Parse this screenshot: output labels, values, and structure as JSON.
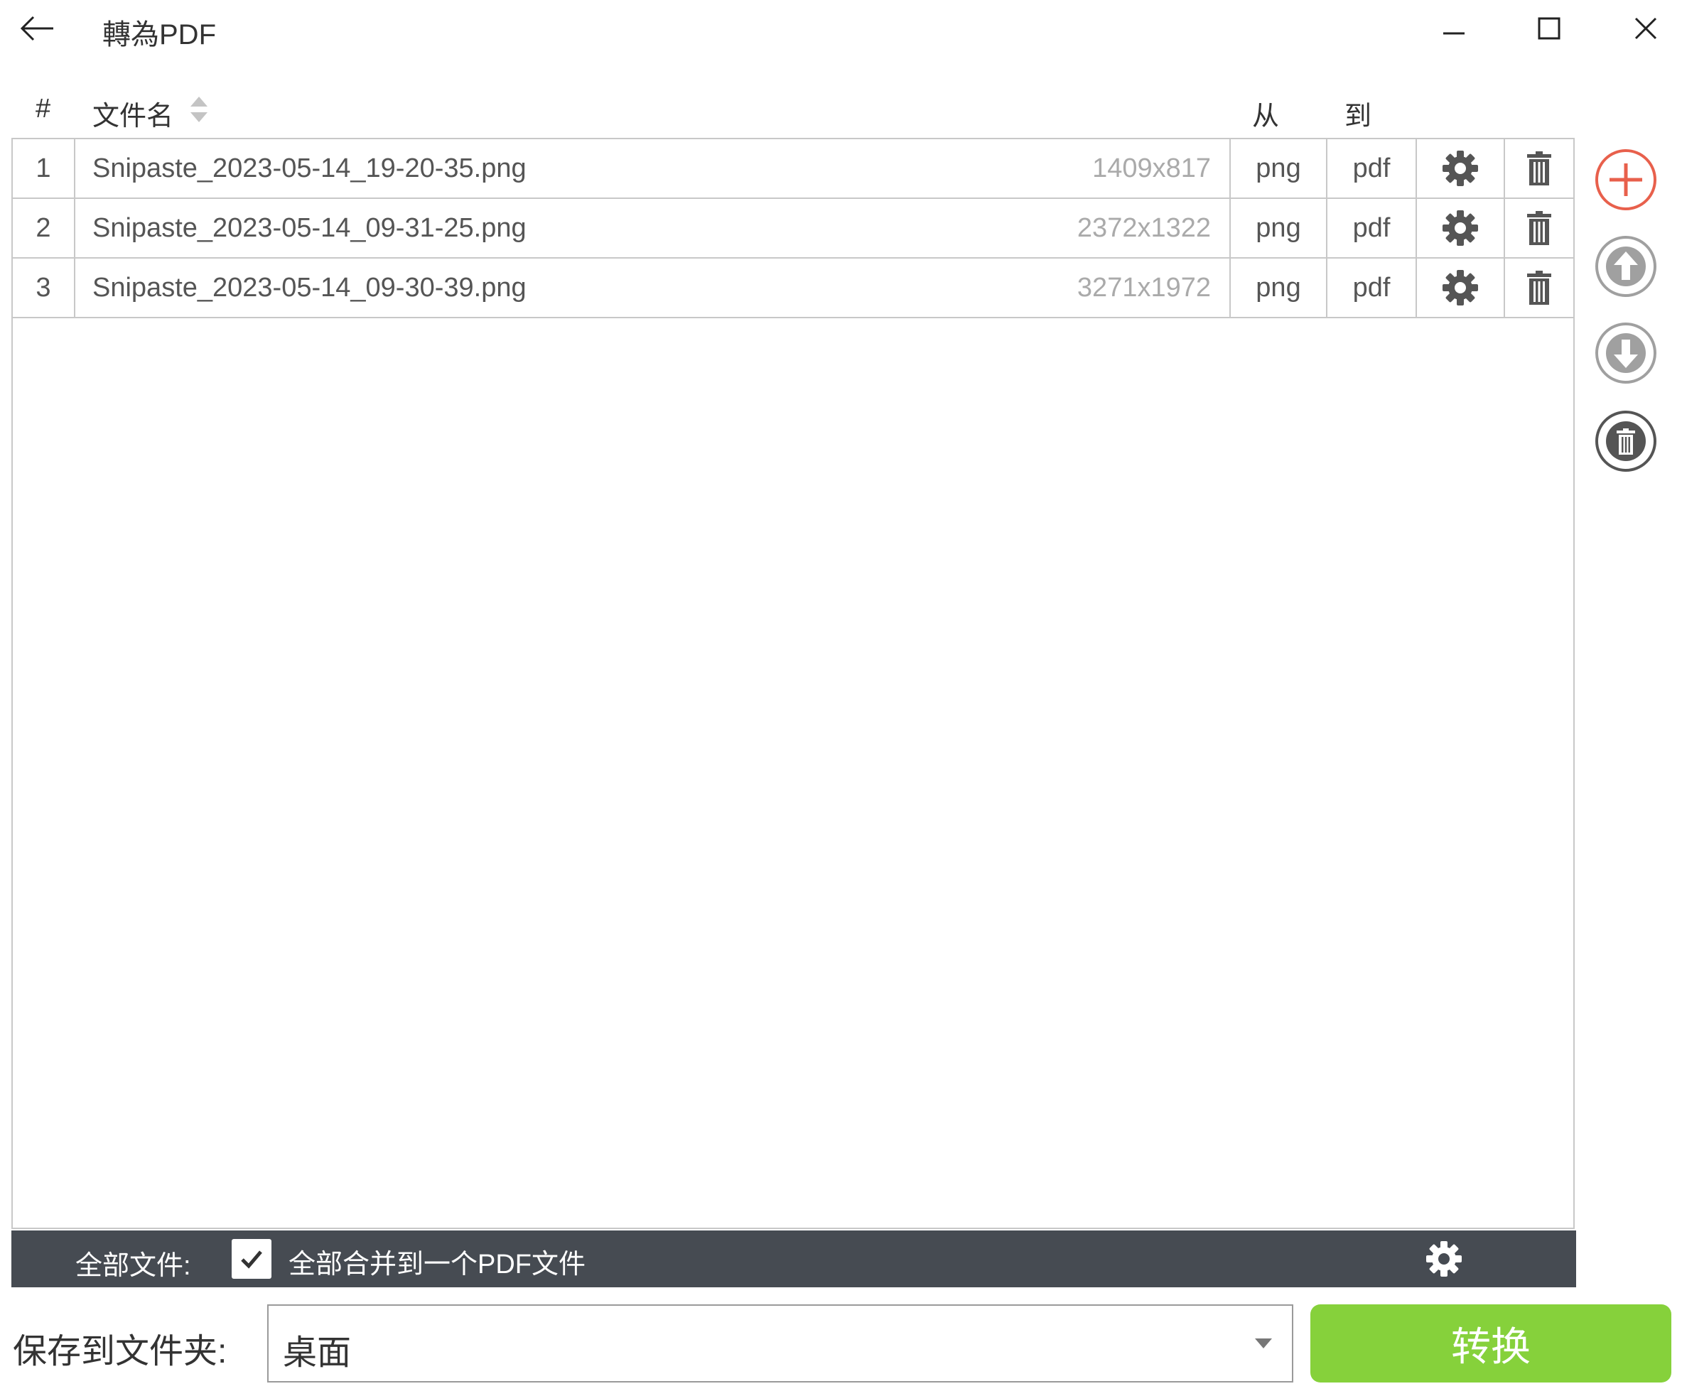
{
  "window": {
    "title": "轉為PDF"
  },
  "table": {
    "headers": {
      "num": "#",
      "filename": "文件名",
      "from": "从",
      "to": "到"
    },
    "rows": [
      {
        "num": "1",
        "name": "Snipaste_2023-05-14_19-20-35.png",
        "dims": "1409x817",
        "from": "png",
        "to": "pdf"
      },
      {
        "num": "2",
        "name": "Snipaste_2023-05-14_09-31-25.png",
        "dims": "2372x1322",
        "from": "png",
        "to": "pdf"
      },
      {
        "num": "3",
        "name": "Snipaste_2023-05-14_09-30-39.png",
        "dims": "3271x1972",
        "from": "png",
        "to": "pdf"
      }
    ]
  },
  "footer": {
    "all_files_label": "全部文件:",
    "merge_checked": true,
    "merge_label": "全部合并到一个PDF文件"
  },
  "save": {
    "label": "保存到文件夹:",
    "folder": "桌面"
  },
  "convert_label": "转换",
  "colors": {
    "add": "#e8604c",
    "convert": "#86d13b",
    "footer_bar": "#464b52",
    "icon_gray": "#a0a0a0",
    "icon_dark": "#555555"
  },
  "icons": {
    "back": "back-arrow-icon",
    "minimize": "minimize-icon",
    "maximize": "maximize-icon",
    "close": "close-icon",
    "sort": "sort-icon",
    "settings": "gear-icon",
    "delete": "trash-icon",
    "add": "add-circle-icon",
    "move_up": "arrow-up-circle-icon",
    "move_down": "arrow-down-circle-icon",
    "delete_all": "trash-circle-icon",
    "dropdown": "dropdown-arrow-icon"
  }
}
